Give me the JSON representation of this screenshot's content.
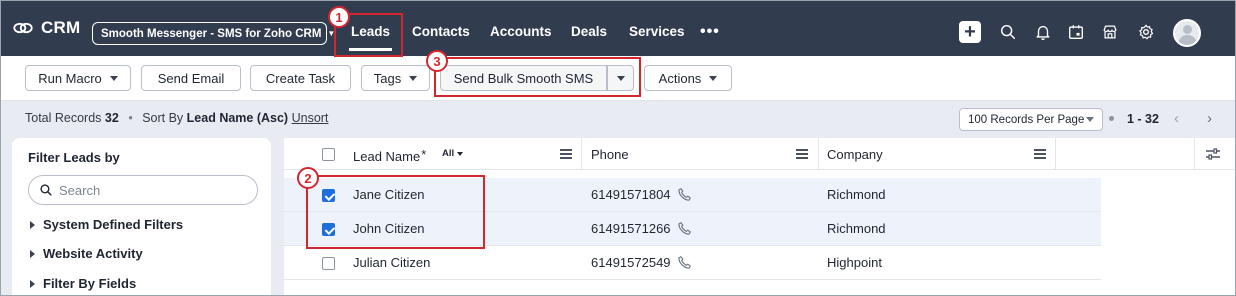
{
  "topnav": {
    "logo_text": "CRM",
    "org_select": "Smooth Messenger - SMS for Zoho CRM",
    "tabs": [
      {
        "label": "Leads",
        "active": true
      },
      {
        "label": "Contacts"
      },
      {
        "label": "Accounts"
      },
      {
        "label": "Deals"
      },
      {
        "label": "Services"
      }
    ],
    "more_label": "•••",
    "icons": [
      "plus-icon",
      "search-icon",
      "bell-icon",
      "calendar-icon",
      "marketplace-icon",
      "gear-icon",
      "avatar"
    ]
  },
  "toolbar": {
    "run_macro": "Run Macro",
    "send_email": "Send Email",
    "create_task": "Create Task",
    "tags": "Tags",
    "send_bulk_sms": "Send Bulk Smooth SMS",
    "actions": "Actions"
  },
  "records": {
    "total_label": "Total Records",
    "total_count": "32",
    "sort_label": "Sort By",
    "sort_value": "Lead Name (Asc)",
    "unsort": "Unsort",
    "per_page": "100 Records Per Page",
    "range": "1 - 32"
  },
  "filter": {
    "title": "Filter Leads by",
    "search_placeholder": "Search",
    "items": [
      "System Defined Filters",
      "Website Activity",
      "Filter By Fields"
    ]
  },
  "grid": {
    "columns": {
      "name": "Lead Name",
      "name_required": "*",
      "name_filter": "All",
      "phone": "Phone",
      "company": "Company"
    },
    "rows": [
      {
        "name": "Jane Citizen",
        "phone": "61491571804",
        "company": "Richmond",
        "checked": true
      },
      {
        "name": "John Citizen",
        "phone": "61491571266",
        "company": "Richmond",
        "checked": true
      },
      {
        "name": "Julian Citizen",
        "phone": "61491572549",
        "company": "Highpoint",
        "checked": false
      }
    ]
  },
  "annotations": {
    "accent_color": "#d3272f",
    "steps": [
      "1",
      "2",
      "3"
    ]
  }
}
